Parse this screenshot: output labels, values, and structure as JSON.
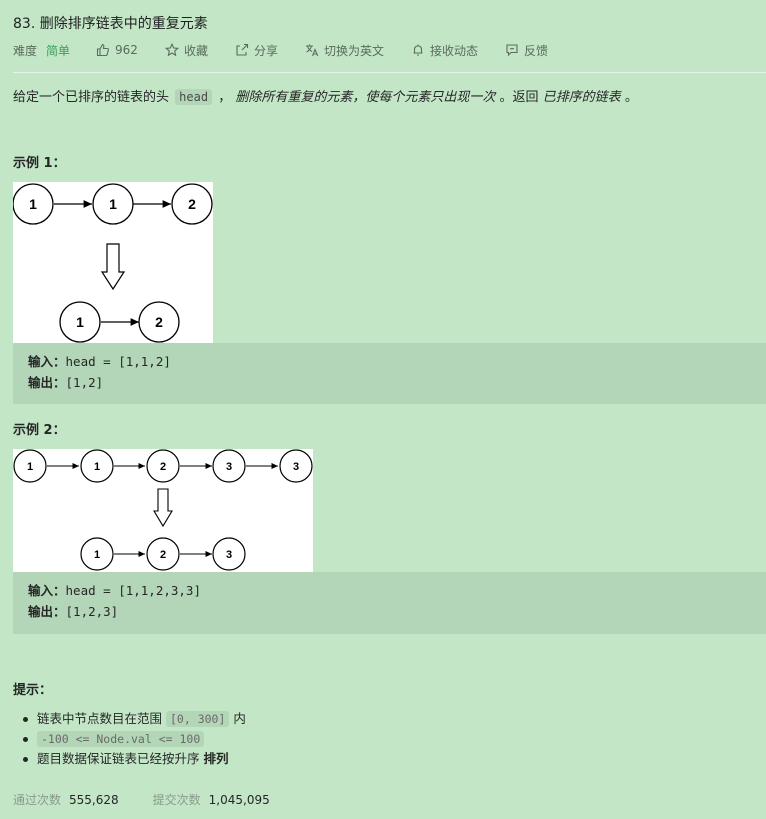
{
  "title": "83. 删除排序链表中的重复元素",
  "meta": {
    "difficulty_label": "难度",
    "difficulty_value": "简单",
    "likes": "962",
    "collect": "收藏",
    "share": "分享",
    "switch_lang": "切换为英文",
    "subscribe": "接收动态",
    "feedback": "反馈"
  },
  "description": {
    "p1": "给定一个已排序的链表的头",
    "code": "head",
    "p2": "，",
    "emph1": "删除所有重复的元素，使每个元素只出现一次",
    "p3": "。返回",
    "emph2": "已排序的链表",
    "p4": "。"
  },
  "example1": {
    "heading": "示例 1：",
    "diagram_top": [
      "1",
      "1",
      "2"
    ],
    "diagram_bottom": [
      "1",
      "2"
    ],
    "input_label": "输入：",
    "input": "head = [1,1,2]",
    "output_label": "输出：",
    "output": "[1,2]"
  },
  "example2": {
    "heading": "示例 2：",
    "diagram_top": [
      "1",
      "1",
      "2",
      "3",
      "3"
    ],
    "diagram_bottom": [
      "1",
      "2",
      "3"
    ],
    "input_label": "输入：",
    "input": "head = [1,1,2,3,3]",
    "output_label": "输出：",
    "output": "[1,2,3]"
  },
  "hints": {
    "heading": "提示：",
    "h1_pre": "链表中节点数目在范围",
    "h1_code": "[0, 300]",
    "h1_post": "内",
    "h2_code": "-100 <= Node.val <= 100",
    "h3_pre": "题目数据保证链表已经按升序",
    "h3_bold": "排列"
  },
  "stats": {
    "accepted_label": "通过次数",
    "accepted": "555,628",
    "submitted_label": "提交次数",
    "submitted": "1,045,095"
  }
}
